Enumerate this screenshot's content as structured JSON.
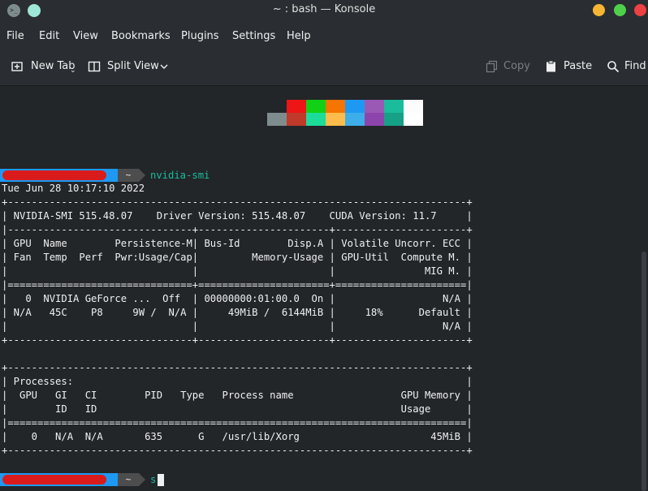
{
  "window": {
    "title": "~ : bash — Konsole",
    "app_icon": "terminal-icon"
  },
  "menu": [
    "File",
    "Edit",
    "View",
    "Bookmarks",
    "Plugins",
    "Settings",
    "Help"
  ],
  "toolbar": {
    "new_tab": "New Tab",
    "split_view": "Split View",
    "copy": "Copy",
    "paste": "Paste",
    "find": "Find"
  },
  "palette": {
    "top": [
      "#ed1515",
      "#11d116",
      "#f67400",
      "#1d99f3",
      "#9b59b6",
      "#1abc9c",
      "#fcfcfc"
    ],
    "bottom": [
      "#7f8c8d",
      "#c0392b",
      "#1cdc9a",
      "#fdbc4b",
      "#3daee9",
      "#8e44ad",
      "#16a085",
      "#ffffff"
    ]
  },
  "prompt": {
    "dir": "~",
    "command1": "nvidia-smi",
    "command2": "s"
  },
  "output": [
    "Tue Jun 28 10:17:10 2022",
    "+-----------------------------------------------------------------------------+",
    "| NVIDIA-SMI 515.48.07    Driver Version: 515.48.07    CUDA Version: 11.7     |",
    "|-------------------------------+----------------------+----------------------+",
    "| GPU  Name        Persistence-M| Bus-Id        Disp.A | Volatile Uncorr. ECC |",
    "| Fan  Temp  Perf  Pwr:Usage/Cap|         Memory-Usage | GPU-Util  Compute M. |",
    "|                               |                      |               MIG M. |",
    "|===============================+======================+======================|",
    "|   0  NVIDIA GeForce ...  Off  | 00000000:01:00.0  On |                  N/A |",
    "| N/A   45C    P8     9W /  N/A |     49MiB /  6144MiB |     18%      Default |",
    "|                               |                      |                  N/A |",
    "+-------------------------------+----------------------+----------------------+",
    "",
    "+-----------------------------------------------------------------------------+",
    "| Processes:                                                                  |",
    "|  GPU   GI   CI        PID   Type   Process name                  GPU Memory |",
    "|        ID   ID                                                   Usage      |",
    "|=============================================================================|",
    "|    0   N/A  N/A       635      G   /usr/lib/Xorg                      45MiB |",
    "+-----------------------------------------------------------------------------+"
  ]
}
